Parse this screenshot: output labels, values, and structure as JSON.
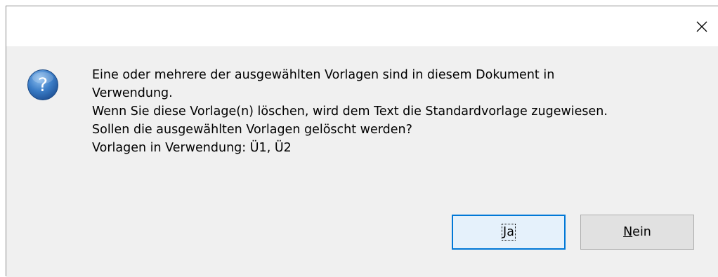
{
  "window": {
    "close_icon": "close-icon"
  },
  "dialog": {
    "icon": "question-icon",
    "icon_glyph": "?",
    "message_lines": [
      "Eine oder mehrere der ausgewählten Vorlagen sind in diesem Dokument in",
      "Verwendung.",
      "Wenn Sie diese Vorlage(n) löschen, wird dem Text die Standardvorlage zugewiesen.",
      "Sollen die ausgewählten Vorlagen gelöscht werden?",
      "Vorlagen in Verwendung: Ü1, Ü2"
    ]
  },
  "buttons": {
    "yes": {
      "mnemonic": "J",
      "rest": "a",
      "label": "Ja"
    },
    "no": {
      "mnemonic": "N",
      "rest": "ein",
      "label": "Nein"
    }
  },
  "colors": {
    "accent": "#0078d7",
    "dialog_bg": "#f0f0f0",
    "icon_blue": "#2f6fb5"
  }
}
